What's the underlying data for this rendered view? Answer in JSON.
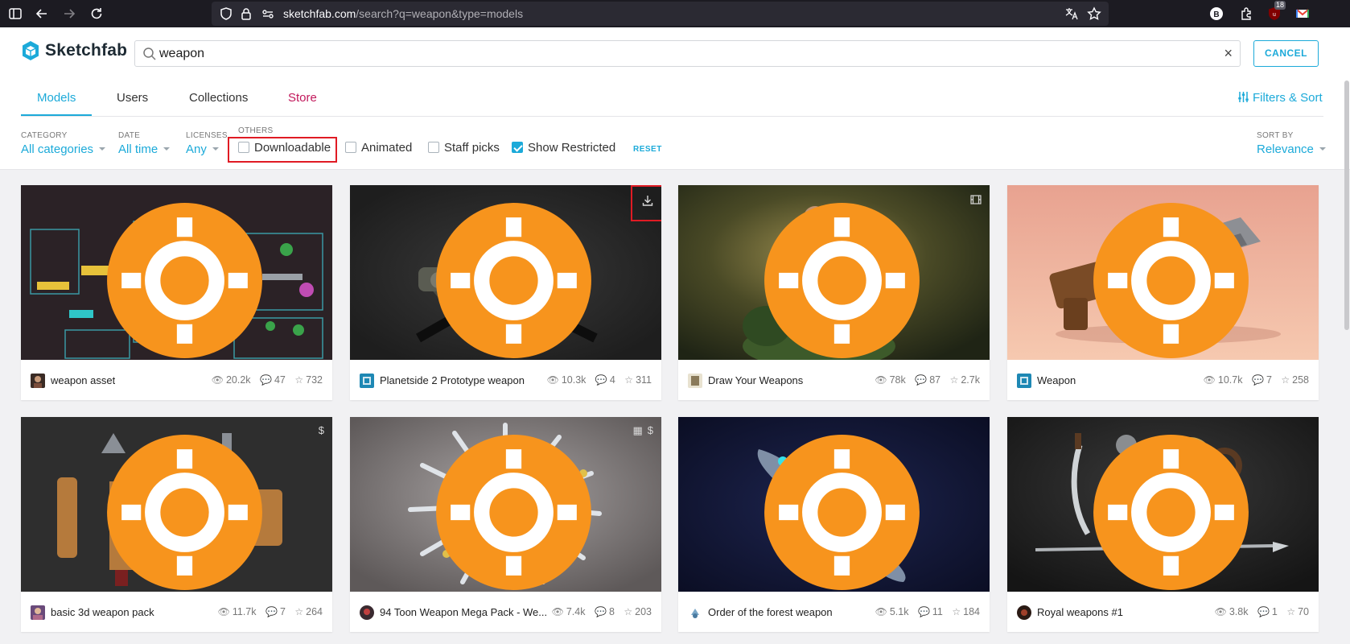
{
  "browser": {
    "url_host": "sketchfab.com",
    "url_path": "/search?q=weapon&type=models",
    "ext_badge_count": "18"
  },
  "brand": {
    "name": "Sketchfab"
  },
  "search": {
    "value": "weapon",
    "clear_icon": "×",
    "cancel_label": "CANCEL"
  },
  "tabs": [
    {
      "label": "Models"
    },
    {
      "label": "Users"
    },
    {
      "label": "Collections"
    },
    {
      "label": "Store"
    }
  ],
  "filters_sort_label": "Filters & Sort",
  "filters": {
    "category": {
      "label": "CATEGORY",
      "value": "All categories"
    },
    "date": {
      "label": "DATE",
      "value": "All time"
    },
    "licenses": {
      "label": "LICENSES",
      "value": "Any"
    },
    "others": {
      "label": "OTHERS",
      "options": [
        {
          "label": "Downloadable",
          "checked": false
        },
        {
          "label": "Animated",
          "checked": false
        },
        {
          "label": "Staff picks",
          "checked": false
        },
        {
          "label": "Show Restricted",
          "checked": true
        }
      ]
    },
    "reset_label": "RESET",
    "sort": {
      "label": "SORT BY",
      "value": "Relevance"
    }
  },
  "cards": [
    {
      "title": "weapon asset",
      "views": "20.2k",
      "comments": "47",
      "likes": "732",
      "staff_pick": true
    },
    {
      "title": "Planetside 2 Prototype weapon",
      "views": "10.3k",
      "comments": "4",
      "likes": "311",
      "staff_pick": true,
      "corner": "download-icon"
    },
    {
      "title": "Draw Your Weapons",
      "views": "78k",
      "comments": "87",
      "likes": "2.7k",
      "staff_pick": true,
      "corner": "animated-icon"
    },
    {
      "title": "Weapon",
      "views": "10.7k",
      "comments": "7",
      "likes": "258",
      "staff_pick": true
    },
    {
      "title": "basic 3d weapon pack",
      "views": "11.7k",
      "comments": "7",
      "likes": "264",
      "staff_pick": true,
      "corner": "price-icon"
    },
    {
      "title": "94 Toon Weapon Mega Pack - We...",
      "views": "7.4k",
      "comments": "8",
      "likes": "203",
      "staff_pick": true,
      "corner": "animated-price-icon"
    },
    {
      "title": "Order of the forest weapon",
      "views": "5.1k",
      "comments": "11",
      "likes": "184",
      "staff_pick": true
    },
    {
      "title": "Royal weapons #1",
      "views": "3.8k",
      "comments": "1",
      "likes": "70",
      "staff_pick": true
    }
  ],
  "colors": {
    "accent": "#1caad9",
    "store": "#c2185b",
    "highlight": "#e01b24",
    "staff_badge": "#f7941d"
  }
}
